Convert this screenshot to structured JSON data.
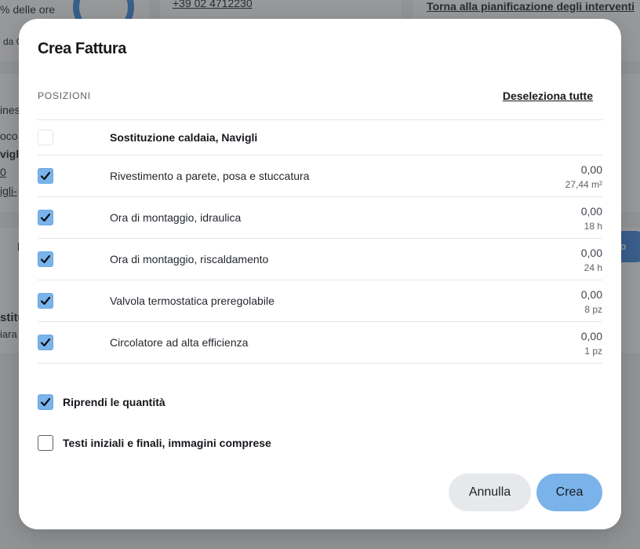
{
  "background": {
    "hours_fragment": "% delle ore",
    "phone_link": "+39 02 4712230",
    "back_link": "Torna alla pianificazione degli interventi",
    "fragment_da": "da C",
    "fragment_ines": "ines",
    "fragment_oco": "oco",
    "fragment_vigli": "vigli",
    "fragment_zero": "0",
    "fragment_igli": "igli-",
    "fragment_stitu": "stitu",
    "fragment_iara": "iara",
    "fragment_l": "l",
    "fragment_to": "to"
  },
  "modal": {
    "title": "Crea Fattura",
    "section_label": "POSIZIONI",
    "deselect_all": "Deseleziona tutte",
    "group": {
      "label": "Sostituzione caldaia, Navigli",
      "checked": false
    },
    "items": [
      {
        "label": "Rivestimento a parete, posa e stuccatura",
        "amount": "0,00",
        "qty": "27,44 m²",
        "checked": true
      },
      {
        "label": "Ora di montaggio, idraulica",
        "amount": "0,00",
        "qty": "18 h",
        "checked": true
      },
      {
        "label": "Ora di montaggio, riscaldamento",
        "amount": "0,00",
        "qty": "24 h",
        "checked": true
      },
      {
        "label": "Valvola termostatica preregolabile",
        "amount": "0,00",
        "qty": "8 pz",
        "checked": true
      },
      {
        "label": "Circolatore ad alta efficienza",
        "amount": "0,00",
        "qty": "1 pz",
        "checked": true
      }
    ],
    "options": {
      "take_quantities": {
        "label": "Riprendi le quantità",
        "checked": true
      },
      "include_texts": {
        "label": "Testi iniziali e finali, immagini comprese",
        "checked": false
      }
    },
    "buttons": {
      "cancel": "Annulla",
      "create": "Crea"
    }
  },
  "colors": {
    "accent": "#7ab3ea",
    "overlay": "rgba(40,42,46,0.48)",
    "button_secondary": "#e6e8eb"
  }
}
